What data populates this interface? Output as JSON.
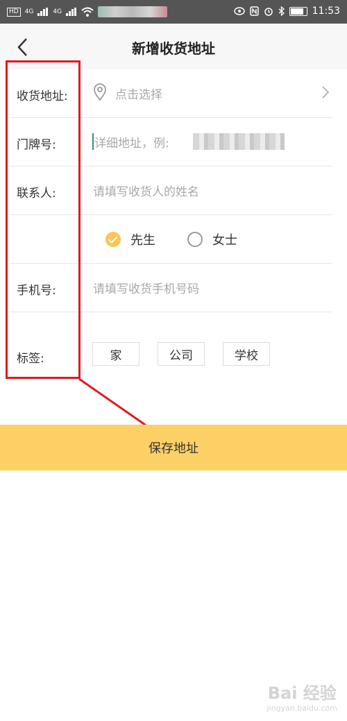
{
  "status_bar": {
    "left_hd": "HD",
    "net1": "4G",
    "net2": "4G",
    "time": "11:53"
  },
  "header": {
    "title": "新增收货地址"
  },
  "form": {
    "address_label": "收货地址:",
    "address_placeholder": "点击选择",
    "door_label": "门牌号:",
    "door_placeholder": "详细地址，例:",
    "contact_label": "联系人:",
    "contact_placeholder": "请填写收货人的姓名",
    "gender_options": [
      {
        "label": "先生",
        "selected": true
      },
      {
        "label": "女士",
        "selected": false
      }
    ],
    "phone_label": "手机号:",
    "phone_placeholder": "请填写收货手机号码",
    "tag_label": "标签:",
    "tags": [
      "家",
      "公司",
      "学校"
    ]
  },
  "save_button": {
    "label": "保存地址"
  },
  "watermark": {
    "brand": "Bai 经验",
    "url": "jingyan.baidu.com"
  },
  "colors": {
    "accent": "#fdd066",
    "annotation": "#e0191f",
    "checked": "#f9c557"
  }
}
